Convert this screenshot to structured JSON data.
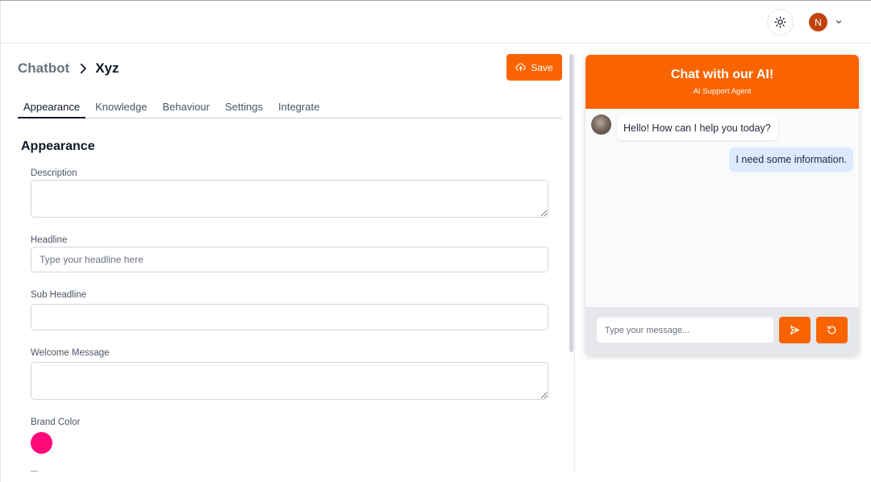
{
  "topbar": {
    "theme_icon": "sun-icon",
    "user_initial": "N",
    "user_menu_icon": "chevron-down-icon"
  },
  "breadcrumb": {
    "root": "Chatbot",
    "current": "Xyz"
  },
  "toolbar": {
    "save_label": "Save",
    "save_icon": "cloud-upload-icon"
  },
  "tabs": [
    {
      "label": "Appearance",
      "active": true
    },
    {
      "label": "Knowledge",
      "active": false
    },
    {
      "label": "Behaviour",
      "active": false
    },
    {
      "label": "Settings",
      "active": false
    },
    {
      "label": "Integrate",
      "active": false
    }
  ],
  "appearance": {
    "title": "Appearance",
    "description": {
      "label": "Description",
      "value": ""
    },
    "headline": {
      "label": "Headline",
      "value": "",
      "placeholder": "Type your headline here"
    },
    "sub_headline": {
      "label": "Sub Headline",
      "value": ""
    },
    "welcome_message": {
      "label": "Welcome Message",
      "value": ""
    },
    "brand_color": {
      "label": "Brand Color",
      "value": "#ff0a78"
    }
  },
  "chat_preview": {
    "title": "Chat with our AI!",
    "subtitle": "AI Support Agent",
    "messages": [
      {
        "sender": "bot",
        "text": "Hello! How can I help you today?"
      },
      {
        "sender": "user",
        "text": "I need some information."
      }
    ],
    "input_placeholder": "Type your message...",
    "send_icon": "send-icon",
    "reset_icon": "refresh-icon"
  },
  "colors": {
    "accent": "#fa6400",
    "user_bubble": "#dbeafe",
    "avatar": "#c2410c"
  }
}
